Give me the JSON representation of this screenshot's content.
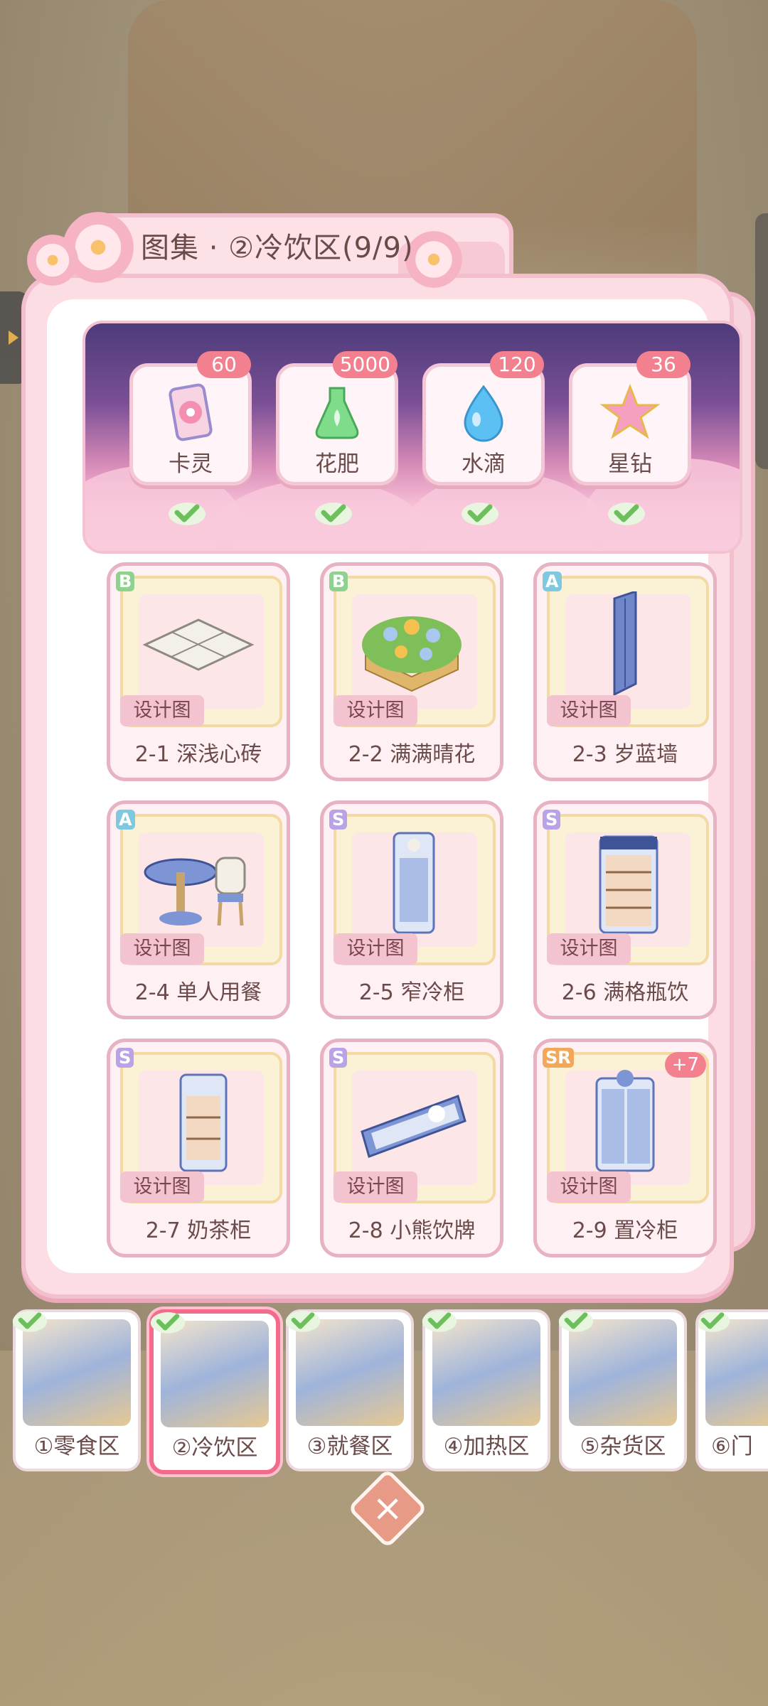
{
  "title": "图集 · ②冷饮区(9/9)",
  "rewards": [
    {
      "name": "卡灵",
      "count": "60",
      "icon": "card-spirit-icon"
    },
    {
      "name": "花肥",
      "count": "5000",
      "icon": "fertilizer-flask-icon"
    },
    {
      "name": "水滴",
      "count": "120",
      "icon": "water-drop-icon"
    },
    {
      "name": "星钻",
      "count": "36",
      "icon": "star-diamond-icon"
    }
  ],
  "design_tag": "设计图",
  "items": [
    {
      "rarity": "B",
      "label": "2-1 深浅心砖"
    },
    {
      "rarity": "B",
      "label": "2-2 满满晴花"
    },
    {
      "rarity": "A",
      "label": "2-3 岁蓝墙"
    },
    {
      "rarity": "A",
      "label": "2-4 单人用餐"
    },
    {
      "rarity": "S",
      "label": "2-5 窄冷柜"
    },
    {
      "rarity": "S",
      "label": "2-6 满格瓶饮"
    },
    {
      "rarity": "S",
      "label": "2-7 奶茶柜"
    },
    {
      "rarity": "S",
      "label": "2-8 小熊饮牌"
    },
    {
      "rarity": "SR",
      "label": "2-9 置冷柜",
      "extra": "+7"
    }
  ],
  "areas": [
    {
      "name": "①零食区"
    },
    {
      "name": "②冷饮区",
      "active": true
    },
    {
      "name": "③就餐区"
    },
    {
      "name": "④加热区"
    },
    {
      "name": "⑤杂货区"
    },
    {
      "name": "⑥门"
    }
  ],
  "colors": {
    "rarity_B": "#8fd18f",
    "rarity_A": "#7fc9e0",
    "rarity_S": "#b9a3e6",
    "rarity_SR": "#f2a75a",
    "check": "#6cbf5c"
  }
}
